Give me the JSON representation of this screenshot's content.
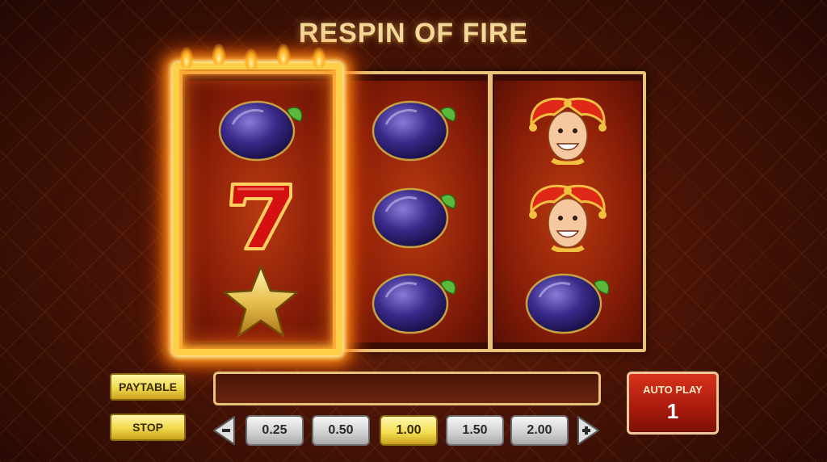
{
  "title": "RESPIN OF FIRE",
  "reels": [
    {
      "symbols": [
        "plum-icon",
        "seven-icon",
        "star-icon"
      ],
      "on_fire": true
    },
    {
      "symbols": [
        "plum-icon",
        "plum-icon",
        "plum-icon"
      ],
      "on_fire": false
    },
    {
      "symbols": [
        "jester-icon",
        "jester-icon",
        "plum-icon"
      ],
      "on_fire": false
    }
  ],
  "controls": {
    "paytable_label": "PAYTABLE",
    "stop_label": "STOP",
    "bet_options": [
      "0.25",
      "0.50",
      "1.00",
      "1.50",
      "2.00"
    ],
    "selected_bet": "1.00",
    "decrease_icon": "minus-arrow-icon",
    "increase_icon": "plus-arrow-icon",
    "autoplay_label": "AUTO PLAY",
    "autoplay_count": "1"
  },
  "colors": {
    "gold": "#e8c27a",
    "reel_red": "#a82a0c",
    "button_yellow": "#f0d84a",
    "autoplay_red": "#c8281a"
  }
}
